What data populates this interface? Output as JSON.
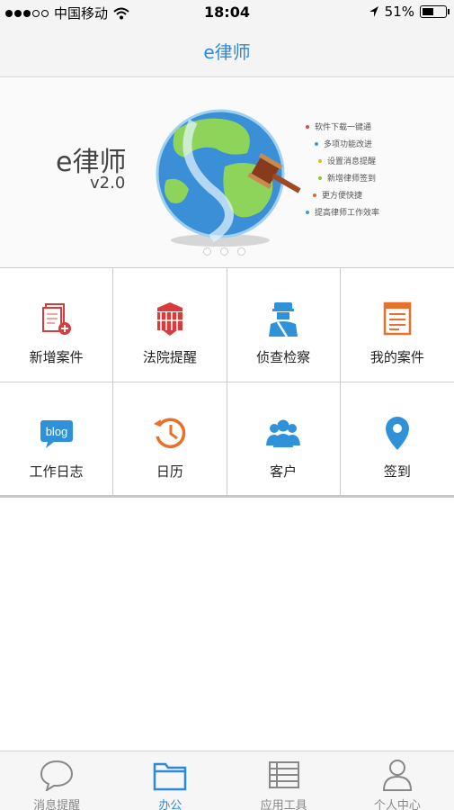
{
  "status_bar": {
    "carrier": "中国移动",
    "time": "18:04",
    "battery": "51%",
    "battery_level": 0.51
  },
  "nav": {
    "title": "e律师"
  },
  "banner": {
    "title": "e律师",
    "version": "v2.0",
    "features": [
      {
        "text": "软件下载一键通",
        "color": "#e04848"
      },
      {
        "text": "多项功能改进",
        "color": "#3a9ad8"
      },
      {
        "text": "设置消息提醒",
        "color": "#e6b820"
      },
      {
        "text": "新增律师签到",
        "color": "#8cc63e"
      },
      {
        "text": "更方便快捷",
        "color": "#e06a2a"
      },
      {
        "text": "提高律师工作效率",
        "color": "#3a9ad8"
      }
    ],
    "page_count": 3
  },
  "grid": {
    "items": [
      {
        "label": "新增案件",
        "icon": "new-case-icon"
      },
      {
        "label": "法院提醒",
        "icon": "court-reminder-icon"
      },
      {
        "label": "侦查检察",
        "icon": "investigation-icon"
      },
      {
        "label": "我的案件",
        "icon": "my-cases-icon"
      },
      {
        "label": "工作日志",
        "icon": "blog-icon",
        "icon_text": "blog"
      },
      {
        "label": "日历",
        "icon": "calendar-history-icon"
      },
      {
        "label": "客户",
        "icon": "clients-icon"
      },
      {
        "label": "签到",
        "icon": "location-pin-icon"
      }
    ]
  },
  "tabs": [
    {
      "label": "消息提醒",
      "icon": "chat-bubble-icon",
      "active": false
    },
    {
      "label": "办公",
      "icon": "folder-icon",
      "active": true
    },
    {
      "label": "应用工具",
      "icon": "list-icon",
      "active": false
    },
    {
      "label": "个人中心",
      "icon": "person-icon",
      "active": false
    }
  ],
  "colors": {
    "accent": "#2b8ad8",
    "red": "#d93a3a",
    "orange": "#e8702a",
    "blue": "#2f92d8"
  }
}
